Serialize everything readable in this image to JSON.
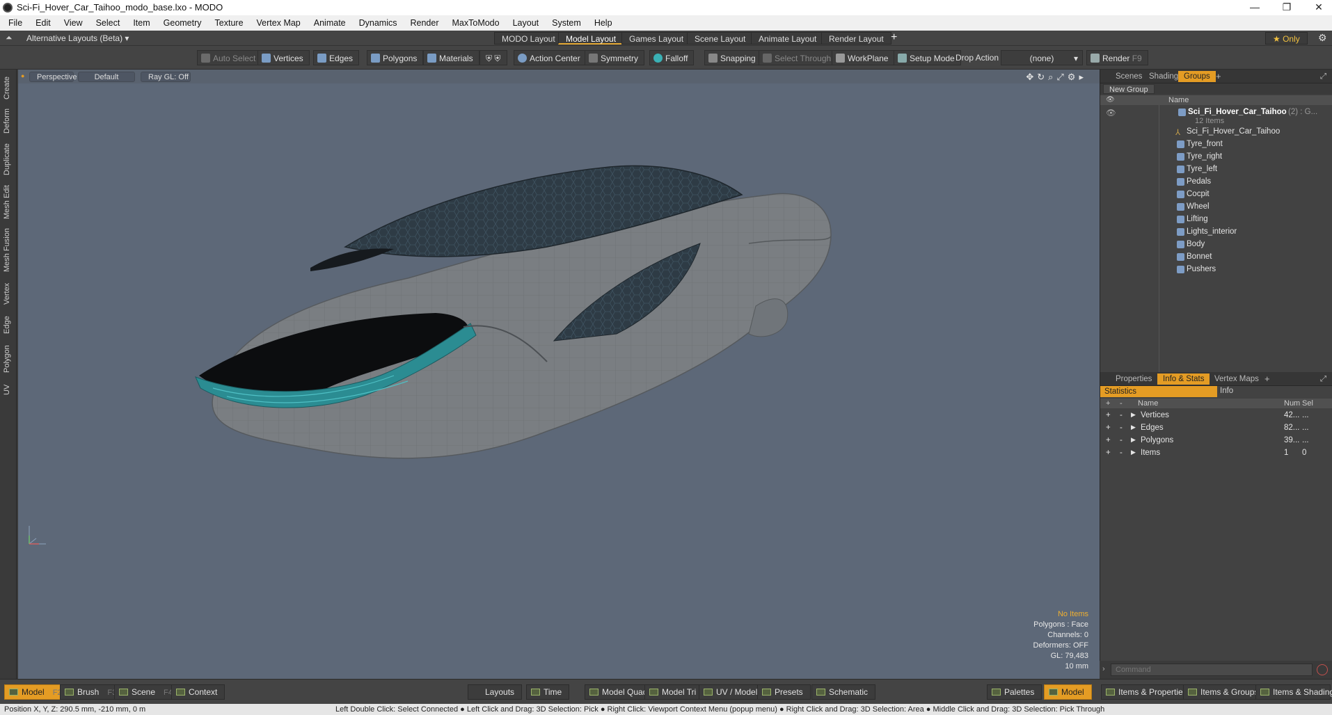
{
  "window": {
    "title": "Sci-Fi_Hover_Car_Taihoo_modo_base.lxo - MODO"
  },
  "menu": [
    "File",
    "Edit",
    "View",
    "Select",
    "Item",
    "Geometry",
    "Texture",
    "Vertex Map",
    "Animate",
    "Dynamics",
    "Render",
    "MaxToModo",
    "Layout",
    "System",
    "Help"
  ],
  "layoutbar": {
    "alt_layouts": "Alternative Layouts (Beta) ▾",
    "tabs": [
      "MODO Layout",
      "Model Layout",
      "Games Layout",
      "Scene Layout",
      "Animate Layout",
      "Render Layout"
    ],
    "active_tab": "Model Layout",
    "add": "+",
    "only": "★ Only"
  },
  "toolbar": {
    "auto_select": "Auto Select",
    "vertices": "Vertices",
    "edges": "Edges",
    "polygons": "Polygons",
    "materials": "Materials",
    "action_center": "Action Center",
    "symmetry": "Symmetry",
    "falloff": "Falloff",
    "snapping": "Snapping",
    "select_through": "Select Through",
    "workplane": "WorkPlane",
    "setup_mode": "Setup Mode",
    "drop_action": "Drop Action",
    "drop_value": "(none)",
    "render": "Render",
    "render_key": "F9"
  },
  "left_tabs": [
    "Create",
    "Deform",
    "Duplicate",
    "Mesh Edit",
    "Mesh Fusion",
    "Vertex",
    "Edge",
    "Polygon",
    "UV"
  ],
  "viewport": {
    "view": "Perspective",
    "shading": "Default",
    "raygl": "Ray GL: Off",
    "info": {
      "items": "No Items",
      "polygons": "Polygons : Face",
      "channels": "Channels: 0",
      "deformers": "Deformers: OFF",
      "gl": "GL: 79,483",
      "unit": "10 mm"
    }
  },
  "groups_panel": {
    "tabs": [
      "Scenes",
      "Shading",
      "Groups"
    ],
    "active": "Groups",
    "new_group": "New Group",
    "col_name": "Name",
    "root": "Sci_Fi_Hover_Car_Taihoo",
    "root_suffix": "(2) : G...",
    "root_count": "12 Items",
    "items": [
      "Sci_Fi_Hover_Car_Taihoo",
      "Tyre_front",
      "Tyre_right",
      "Tyre_left",
      "Pedals",
      "Cocpit",
      "Wheel",
      "Lifting",
      "Lights_interior",
      "Body",
      "Bonnet",
      "Pushers"
    ]
  },
  "props_panel": {
    "tabs": [
      "Properties",
      "Info & Stats",
      "Vertex Maps"
    ],
    "active": "Info & Stats",
    "subtabs": [
      "Statistics",
      "Info"
    ],
    "col_name": "Name",
    "col_num": "Num",
    "col_sel": "Sel",
    "rows": [
      {
        "name": "Vertices",
        "num": "42...",
        "sel": "..."
      },
      {
        "name": "Edges",
        "num": "82...",
        "sel": "..."
      },
      {
        "name": "Polygons",
        "num": "39...",
        "sel": "..."
      },
      {
        "name": "Items",
        "num": "1",
        "sel": "0"
      }
    ]
  },
  "command": {
    "placeholder": "Command"
  },
  "bottom": {
    "model": "Model",
    "model_key": "F2",
    "brush": "Brush",
    "brush_key": "F3",
    "scene": "Scene",
    "scene_key": "F4",
    "context": "Context",
    "layouts": "Layouts",
    "time": "Time",
    "model_quad": "Model Quad",
    "model_tri": "Model Tri",
    "uv_model": "UV / Model",
    "presets": "Presets",
    "schematic": "Schematic",
    "palettes": "Palettes",
    "model_right": "Model",
    "items_props": "Items & Properties",
    "items_groups": "Items & Groups",
    "items_shading": "Items & Shading"
  },
  "status": {
    "position": "Position X, Y, Z:   290.5 mm, -210 mm, 0 m",
    "hints": "Left Double Click: Select Connected ● Left Click and Drag: 3D Selection: Pick ● Right Click: Viewport Context Menu (popup menu) ● Right Click and Drag: 3D Selection: Area ● Middle Click and Drag: 3D Selection: Pick Through"
  },
  "colors": {
    "accent": "#e49c24",
    "viewport_bg": "#5d6878",
    "panel_bg": "#3b3b3b"
  }
}
